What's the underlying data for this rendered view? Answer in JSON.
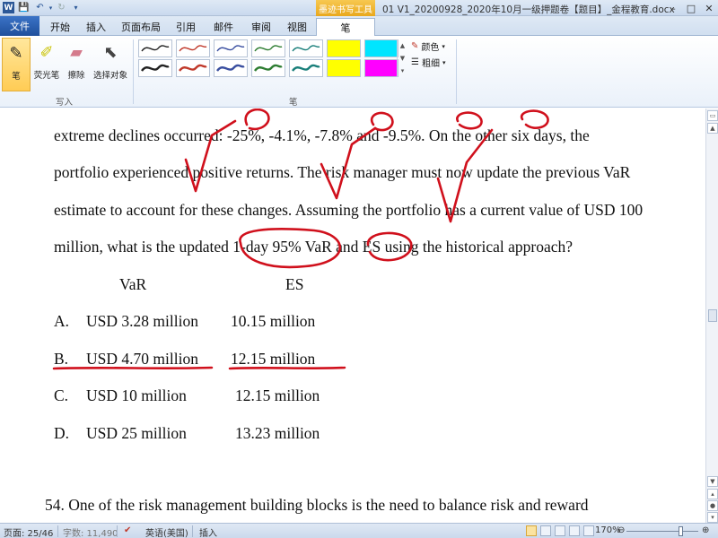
{
  "titlebar": {
    "app_icon": "W",
    "context_tab": "墨迹书写工具",
    "doc_title": "01 V1_20200928_2020年10月一级押题卷【题目】_金程教育.docx",
    "minimize": "–",
    "maximize": "□",
    "close": "✕"
  },
  "tabs": [
    "文件",
    "开始",
    "插入",
    "页面布局",
    "引用",
    "邮件",
    "审阅",
    "视图",
    "笔"
  ],
  "ribbon": {
    "pen_label": "笔",
    "highlighter_label": "荧光笔",
    "eraser_label": "擦除",
    "select_label": "选择对象",
    "group_write": "写入",
    "group_pens": "笔",
    "color_label": "颜色",
    "thickness_label": "粗细",
    "swatch_colors": [
      "#222222",
      "#c0392b",
      "#3a4fa0",
      "#2e7d32",
      "#1a7f7a",
      "#222222",
      "#c0392b",
      "#3a4fa0",
      "#2e7d32",
      "#1a7f7a"
    ],
    "highlighter_colors": [
      "#ffff00",
      "#00e5ff",
      "#ff00ff"
    ]
  },
  "document": {
    "lines": [
      "extreme declines occurred: -25%, -4.1%, -7.8% and -9.5%. On the other six days, the",
      "portfolio experienced positive returns. The risk manager must now update the previous VaR",
      "estimate to account for these changes. Assuming the portfolio has a current value of USD 100",
      "million, what is the updated 1-day 95% VaR and ES using the historical approach?"
    ],
    "col_var": "VaR",
    "col_es": "ES",
    "options": [
      {
        "letter": "A.",
        "var": "USD 3.28 million",
        "es": "10.15 million"
      },
      {
        "letter": "B.",
        "var": "USD 4.70 million",
        "es": "12.15 million"
      },
      {
        "letter": "C.",
        "var": "USD 10 million",
        "es": "12.15 million"
      },
      {
        "letter": "D.",
        "var": "USD 25 million",
        "es": "13.23 million"
      }
    ],
    "next_question": "54. One of the risk management building blocks is the need to balance risk and reward"
  },
  "statusbar": {
    "page": "页面: 25/46",
    "words": "字数: 11,490",
    "language": "英语(美国)",
    "mode": "插入",
    "zoom": "170%"
  }
}
